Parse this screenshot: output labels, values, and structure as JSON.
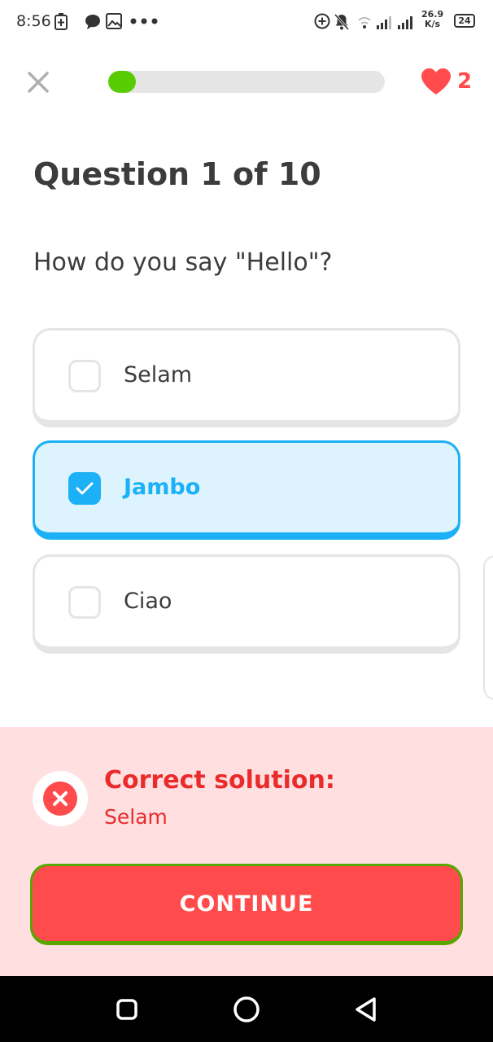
{
  "status_bar": {
    "time": "8:56",
    "net_speed_value": "26.9",
    "net_speed_unit": "K/s",
    "battery": "24"
  },
  "lesson": {
    "progress_fraction": 0.1,
    "hearts": "2"
  },
  "question": {
    "title": "Question 1 of 10",
    "prompt": "How do you say \"Hello\"?",
    "options": [
      {
        "label": "Selam",
        "selected": false
      },
      {
        "label": "Jambo",
        "selected": true
      },
      {
        "label": "Ciao",
        "selected": false
      }
    ]
  },
  "feedback": {
    "title": "Correct solution:",
    "answer": "Selam",
    "continue_label": "CONTINUE"
  },
  "colors": {
    "accent_blue": "#1cb0f6",
    "progress_green": "#58cc02",
    "error_red": "#ff4b4b",
    "feedback_bg": "#ffdfe0"
  },
  "icons": {
    "close": "close-icon",
    "heart": "heart-icon",
    "checkmark": "checkmark-icon",
    "error": "error-x-icon",
    "nav_recents": "recents-square-icon",
    "nav_home": "home-circle-icon",
    "nav_back": "back-triangle-icon"
  }
}
